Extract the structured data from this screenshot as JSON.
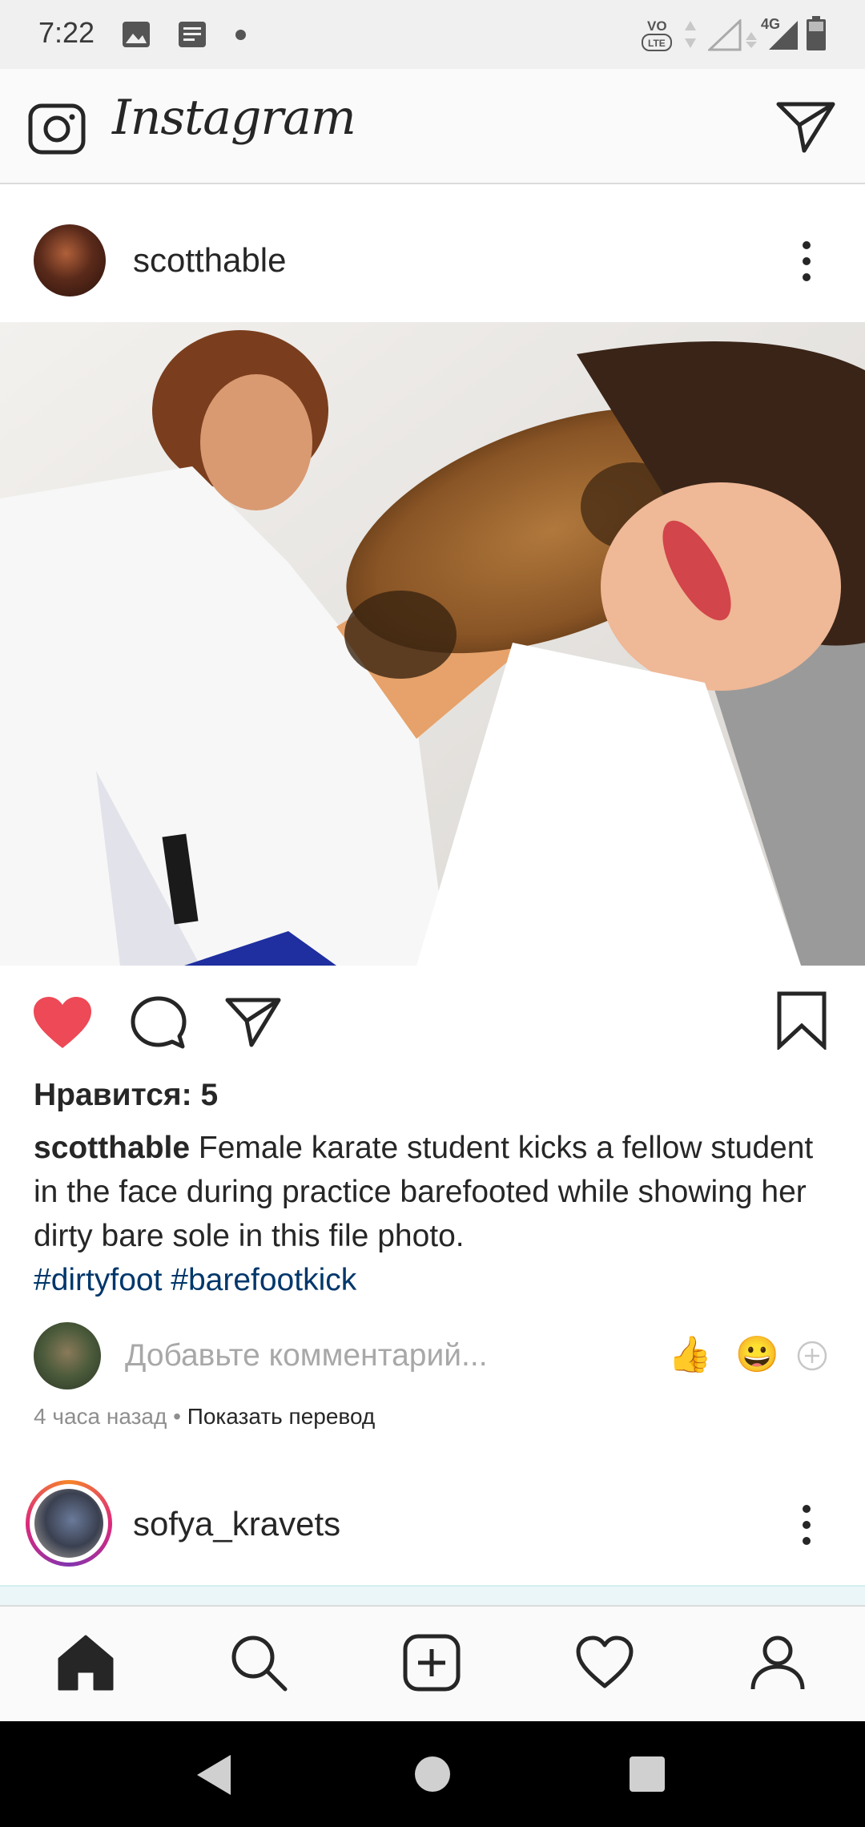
{
  "status_bar": {
    "time": "7:22",
    "left_icons": [
      "image-notification-icon",
      "message-notification-icon",
      "dot-icon"
    ],
    "right_icons": [
      "volte-icon",
      "signal-icon",
      "4g-signal-icon",
      "battery-icon"
    ],
    "network_label": "4G",
    "volte_label": "VoLTE"
  },
  "header": {
    "title": "Instagram",
    "left_icon": "camera-icon",
    "right_icon": "direct-message-icon"
  },
  "post": {
    "username": "scotthable",
    "image_alt": "Karate students in white gi, one kicking the other in the face barefoot",
    "liked": true,
    "likes_text": "Нравится: 5",
    "caption_user": "scotthable",
    "caption_text": "Female karate student kicks a fellow student in the face during practice barefooted while showing her dirty bare sole in this file photo.",
    "hashtags": [
      "#dirtyfoot",
      "#barefootkick"
    ],
    "comment_placeholder": "Добавьте комментарий...",
    "quick_reactions": [
      "👍",
      "😀"
    ],
    "time_ago": "4 часа назад",
    "separator": " • ",
    "translate_label": "Показать перевод"
  },
  "next_post": {
    "username": "sofya_kravets",
    "has_story_ring": true
  },
  "bottom_nav": {
    "items": [
      "home-icon",
      "search-icon",
      "new-post-icon",
      "activity-icon",
      "profile-icon"
    ],
    "active": "home-icon"
  },
  "colors": {
    "like_red": "#ed4956",
    "hashtag_blue": "#00376b",
    "muted_gray": "#8e8e8e"
  }
}
